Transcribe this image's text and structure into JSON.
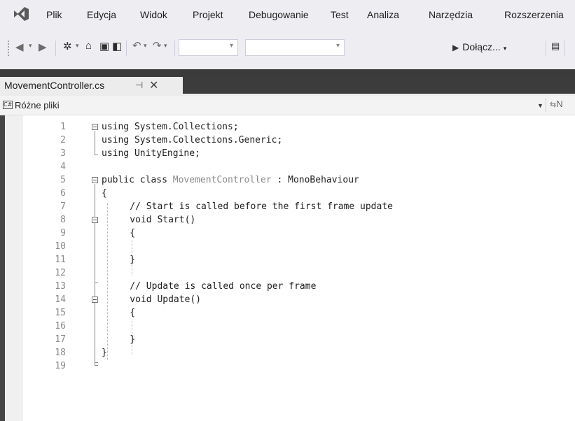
{
  "menu": [
    "Plik",
    "Edycja",
    "Widok",
    "Projekt",
    "Debugowanie",
    "Test",
    "Analiza",
    "Narzędzia",
    "Rozszerzenia"
  ],
  "toolbar": {
    "attach_label": "Dołącz..."
  },
  "tab": {
    "title": "MovementController.cs",
    "pin": "⊣",
    "close": "✕"
  },
  "navbar": {
    "scope": "Różne pliki",
    "member_glyph": "N"
  },
  "code": {
    "line_numbers": [
      "1",
      "2",
      "3",
      "4",
      "5",
      "6",
      "7",
      "8",
      "9",
      "10",
      "11",
      "12",
      "13",
      "14",
      "15",
      "16",
      "17",
      "18",
      "19"
    ],
    "lines": [
      "using System.Collections;",
      "using System.Collections.Generic;",
      "using UnityEngine;",
      "",
      "public class ",
      "{",
      "    // Start is called before the first frame update",
      "    void Start()",
      "    {",
      "",
      "    }",
      "",
      "    // Update is called once per frame",
      "    void Update()",
      "    {",
      "",
      "    }",
      "}",
      ""
    ],
    "class_name": "MovementController",
    "class_suffix": " : MonoBehaviour"
  }
}
